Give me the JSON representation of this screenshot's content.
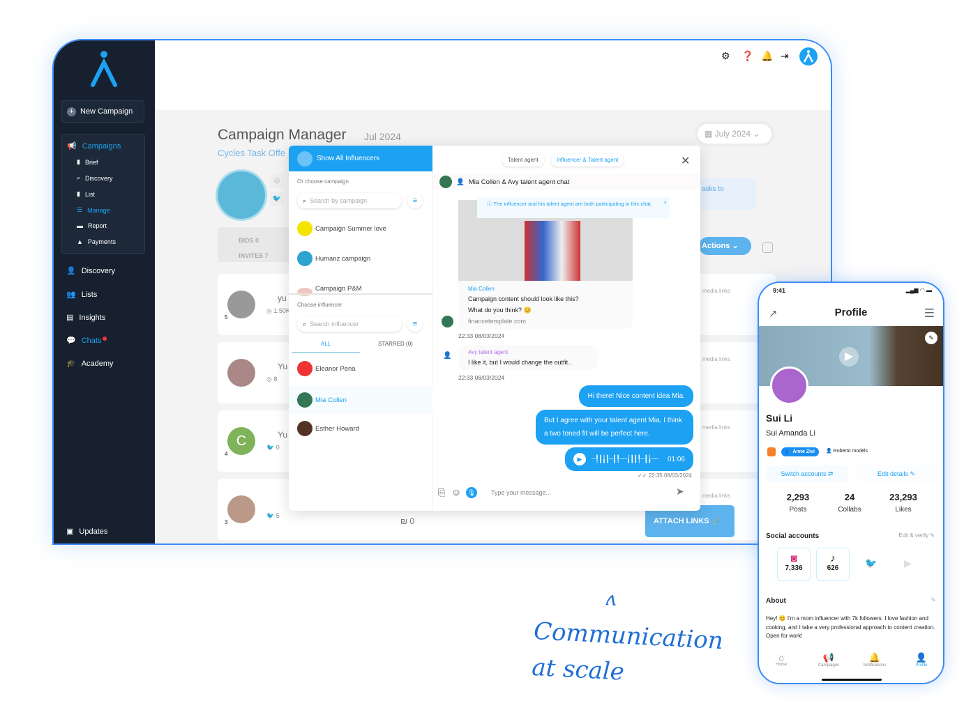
{
  "sidebar": {
    "new_campaign": "New Campaign",
    "campaigns": "Campaigns",
    "sub": [
      "Brief",
      "Discovery",
      "List",
      "Manage",
      "Report",
      "Payments"
    ],
    "nav": [
      "Discovery",
      "Lists",
      "Insights",
      "Chats",
      "Academy"
    ],
    "updates": "Updates"
  },
  "header": {
    "title": "Campaign Manager",
    "date": "Jul 2024",
    "subtitle": "Cycles Task Offe",
    "month_picker": "July 2024",
    "bids_label": "BIDS",
    "bids": "0",
    "invites_label": "INVITES",
    "invites": "7",
    "actions": "Actions",
    "tasks_to": "asks to",
    "attach_links": "ATTACH LINKS",
    "links_partial": "NKS",
    "media_links": "media links",
    "nis": "₪ 0"
  },
  "cards": [
    {
      "name": "yu",
      "stat": "1.50K",
      "rating": "5"
    },
    {
      "name": "Yu",
      "stat": "8",
      "rating": ""
    },
    {
      "name": "Yu",
      "stat": "0",
      "rating": "4",
      "initial": "C"
    },
    {
      "name": "",
      "stat": "5",
      "rating": "3"
    }
  ],
  "modal": {
    "show_all": "Show All Influencers",
    "or_choose": "Or choose campaign",
    "search_campaign": "Search by campaign",
    "campaigns": [
      "Campaign Summer love",
      "Humanz campaign",
      "Campaign P&M"
    ],
    "choose_influencer": "Choose influencer",
    "search_influencer": "Search influencer",
    "tab_all": "ALL",
    "tab_starred": "STARRED (0)",
    "influencers": [
      "Eleanor Pena",
      "Mia Collen",
      "Esther Howard"
    ],
    "chip_talent": "Talent agent",
    "chip_both": "Influencer & Talent agent",
    "chat_title": "Mia Collen & Avy talent agent chat",
    "notice": "The influencer and his talent agent are both participating in this chat.",
    "msg1_author": "Mia Collen",
    "msg1_line1": "Campaign content should look like this?",
    "msg1_line2": "What do you think? 😊",
    "msg1_link": "financetemplate.com",
    "msg1_time": "22:33 08/03/2024",
    "msg2_author": "Avy talent agent",
    "msg2_text": "I like it, but I would change the outfit..",
    "msg2_time": "22:33 08/03/2024",
    "out1": "Hi there! Nice content idea Mia.",
    "out2": "But I agree with your talent agent Mia, I think a two toned fit will be perfect here.",
    "voice_duration": "01:06",
    "out_time": "22:35 08/03/2024",
    "input_placeholder": "Type your message..."
  },
  "phone": {
    "time": "9:41",
    "title": "Profile",
    "display_name": "Sui Li",
    "full_name": "Sui Amanda Li",
    "agent_badge": "Anne Zivi",
    "agency": "Roberto models",
    "switch": "Switch accounts ⇄",
    "edit": "Edit details ✎",
    "stats": [
      {
        "value": "2,293",
        "label": "Posts"
      },
      {
        "value": "24",
        "label": "Collabs"
      },
      {
        "value": "23,293",
        "label": "Likes"
      }
    ],
    "social_title": "Social accounts",
    "edit_verify": "Edit & verify ✎",
    "instagram": "7,336",
    "tiktok": "626",
    "about_title": "About",
    "about": "Hey! 😊 I'm a mom influencer with 7k followers. I love fashion and cooking, and I take a very professional approach to content creation. Open for work!",
    "nav": [
      "Home",
      "Campaigns",
      "Notifications",
      "Profile"
    ]
  },
  "tagline": {
    "line1": "Communication",
    "line2": "at scale"
  },
  "colors": {
    "brand": "#1da1f2",
    "sidebar": "#16202e",
    "frame": "#3b8cf5"
  }
}
